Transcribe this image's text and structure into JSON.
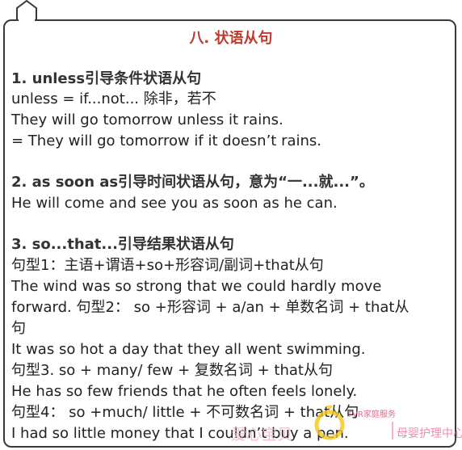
{
  "title": "八. 状语从句",
  "sections": [
    {
      "heading": "1. unless引导条件状语从句",
      "lines": [
        "unless = if...not... 除非，若不",
        "They will go tomorrow unless it rains.",
        "= They will go tomorrow if it doesn’t rains."
      ]
    },
    {
      "heading": "2. as soon as引导时间状语从句，意为“一...就...”。",
      "lines": [
        "He will come and see you as soon as he can."
      ]
    },
    {
      "heading": "3. so...that...引导结果状语从句",
      "lines": [
        "句型1：主语+谓语+so+形容词/副词+that从句",
        "The wind was so strong that we could hardly move",
        "forward. 句型2： so +形容词 + a/an + 单数名词 + that从",
        "句",
        "It was so hot a day that they all went swimming.",
        "句型3.  so + many/ few + 复数名词 + that从句",
        "He has so few friends that he often feels lonely.",
        "句型4： so +much/ little + 不可数名词 + that从句",
        "I had so little money that I couldn’t buy a pen."
      ]
    }
  ],
  "watermarks": {
    "left_text": "爱心宝贝",
    "small_text": "TVR家庭服务",
    "right_text": "母婴护理中心"
  },
  "colors": {
    "title": "#c0392b",
    "watermark_left": "#f3b7c8",
    "watermark_right": "#f07fa0",
    "logo": "#f5c518"
  }
}
